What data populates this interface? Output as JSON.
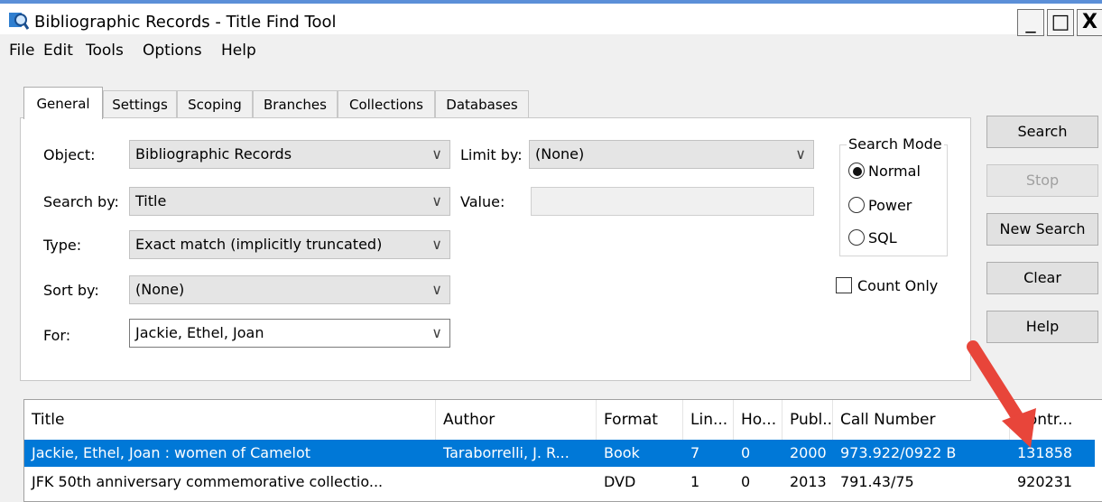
{
  "window": {
    "title": "Bibliographic Records - Title Find Tool",
    "min": "_",
    "max": "□",
    "close": "X"
  },
  "menu": [
    "File",
    "Edit",
    "Tools",
    "Options",
    "Help"
  ],
  "tabs": [
    "General",
    "Settings",
    "Scoping",
    "Branches",
    "Collections",
    "Databases"
  ],
  "form": {
    "object_label": "Object:",
    "object_value": "Bibliographic Records",
    "searchby_label": "Search by:",
    "searchby_value": "Title",
    "type_label": "Type:",
    "type_value": "Exact match (implicitly truncated)",
    "sortby_label": "Sort by:",
    "sortby_value": "(None)",
    "for_label": "For:",
    "for_value": "Jackie, Ethel, Joan",
    "limitby_label": "Limit by:",
    "limitby_value": "(None)",
    "value_label": "Value:",
    "value_value": ""
  },
  "search_mode": {
    "label": "Search Mode",
    "options": [
      "Normal",
      "Power",
      "SQL"
    ],
    "selected": "Normal"
  },
  "count_only": {
    "label": "Count Only",
    "checked": false
  },
  "buttons": {
    "search": "Search",
    "stop": "Stop",
    "new_search": "New Search",
    "clear": "Clear",
    "help": "Help"
  },
  "results": {
    "columns": [
      "Title",
      "Author",
      "Format",
      "Lin...",
      "Ho...",
      "Publ...",
      "Call Number",
      "Contr..."
    ],
    "rows": [
      [
        "Jackie, Ethel, Joan : women of Camelot",
        "Taraborrelli, J. R...",
        "Book",
        "7",
        "0",
        "2000",
        "973.922/0922 B",
        "131858"
      ],
      [
        "JFK 50th anniversary commemorative collectio...",
        "",
        "DVD",
        "1",
        "0",
        "2013",
        "791.43/75",
        "920231"
      ]
    ],
    "selected_row": 0
  },
  "colors": {
    "selection": "#0078d7",
    "arrow": "#e8453a",
    "titlebar_accent": "#5b8fd8"
  }
}
